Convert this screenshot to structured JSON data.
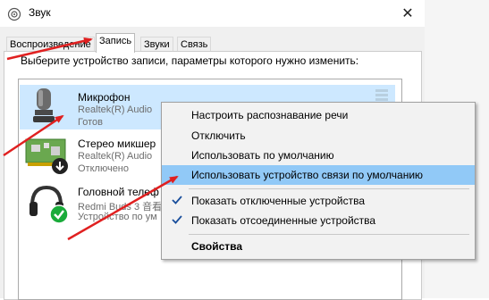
{
  "window": {
    "title": "Звук",
    "close_glyph": "✕",
    "icon": "speaker-icon"
  },
  "tabs": [
    {
      "label": "Воспроизведение"
    },
    {
      "label": "Запись",
      "active": true
    },
    {
      "label": "Звуки"
    },
    {
      "label": "Связь"
    }
  ],
  "instruction": "Выберите устройство записи, параметры которого нужно изменить:",
  "devices": [
    {
      "name": "Микрофон",
      "driver": "Realtek(R) Audio",
      "status": "Готов",
      "icon": "microphone-icon",
      "selected": true
    },
    {
      "name": "Стерео микшер",
      "driver": "Realtek(R) Audio",
      "status": "Отключено",
      "icon": "sound-card-icon"
    },
    {
      "name": "Головной телеф",
      "driver": "Redmi Buds 3 音看",
      "status": "Устройство по ум",
      "icon": "headset-icon"
    }
  ],
  "context_menu": {
    "items": [
      {
        "label": "Настроить распознавание речи"
      },
      {
        "label": "Отключить"
      },
      {
        "label": "Использовать по умолчанию"
      },
      {
        "label": "Использовать устройство связи по умолчанию",
        "highlighted": true
      },
      {
        "label": "Показать отключенные устройства",
        "checked": true
      },
      {
        "label": "Показать отсоединенные устройства",
        "checked": true
      },
      {
        "label": "Свойства",
        "bold": true
      }
    ]
  },
  "colors": {
    "selection": "#cde8ff",
    "menu_highlight": "#91c9f7",
    "annotation_arrow": "#e02020",
    "checkmark": "#1a4f9c",
    "default_badge": "#1aab3a"
  }
}
